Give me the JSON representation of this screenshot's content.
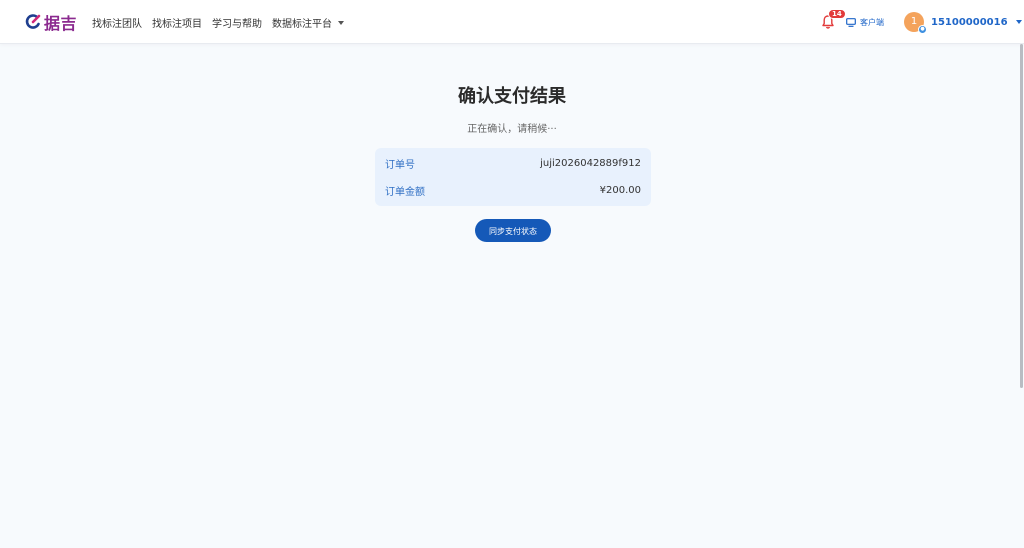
{
  "header": {
    "logo_text": "据吉",
    "nav": [
      {
        "label": "找标注团队"
      },
      {
        "label": "找标注项目"
      },
      {
        "label": "学习与帮助"
      },
      {
        "label": "数据标注平台"
      }
    ],
    "notification_count": "14",
    "client_label": "客户端",
    "user": {
      "avatar_text": "1",
      "username": "15100000016"
    }
  },
  "main": {
    "title": "确认支付结果",
    "subtitle": "正在确认，请稍候···",
    "order": {
      "order_no_label": "订单号",
      "order_no_value": "juji2026042889f912",
      "amount_label": "订单金额",
      "amount_value": "¥200.00"
    },
    "sync_button_label": "同步支付状态"
  },
  "colors": {
    "brand": "#8b2a8f",
    "primary": "#1559b8",
    "badge": "#e23b3b",
    "card_bg": "#e8f1fd"
  },
  "icons": [
    "logo-icon",
    "bell-icon",
    "monitor-icon",
    "chevron-down-icon"
  ]
}
